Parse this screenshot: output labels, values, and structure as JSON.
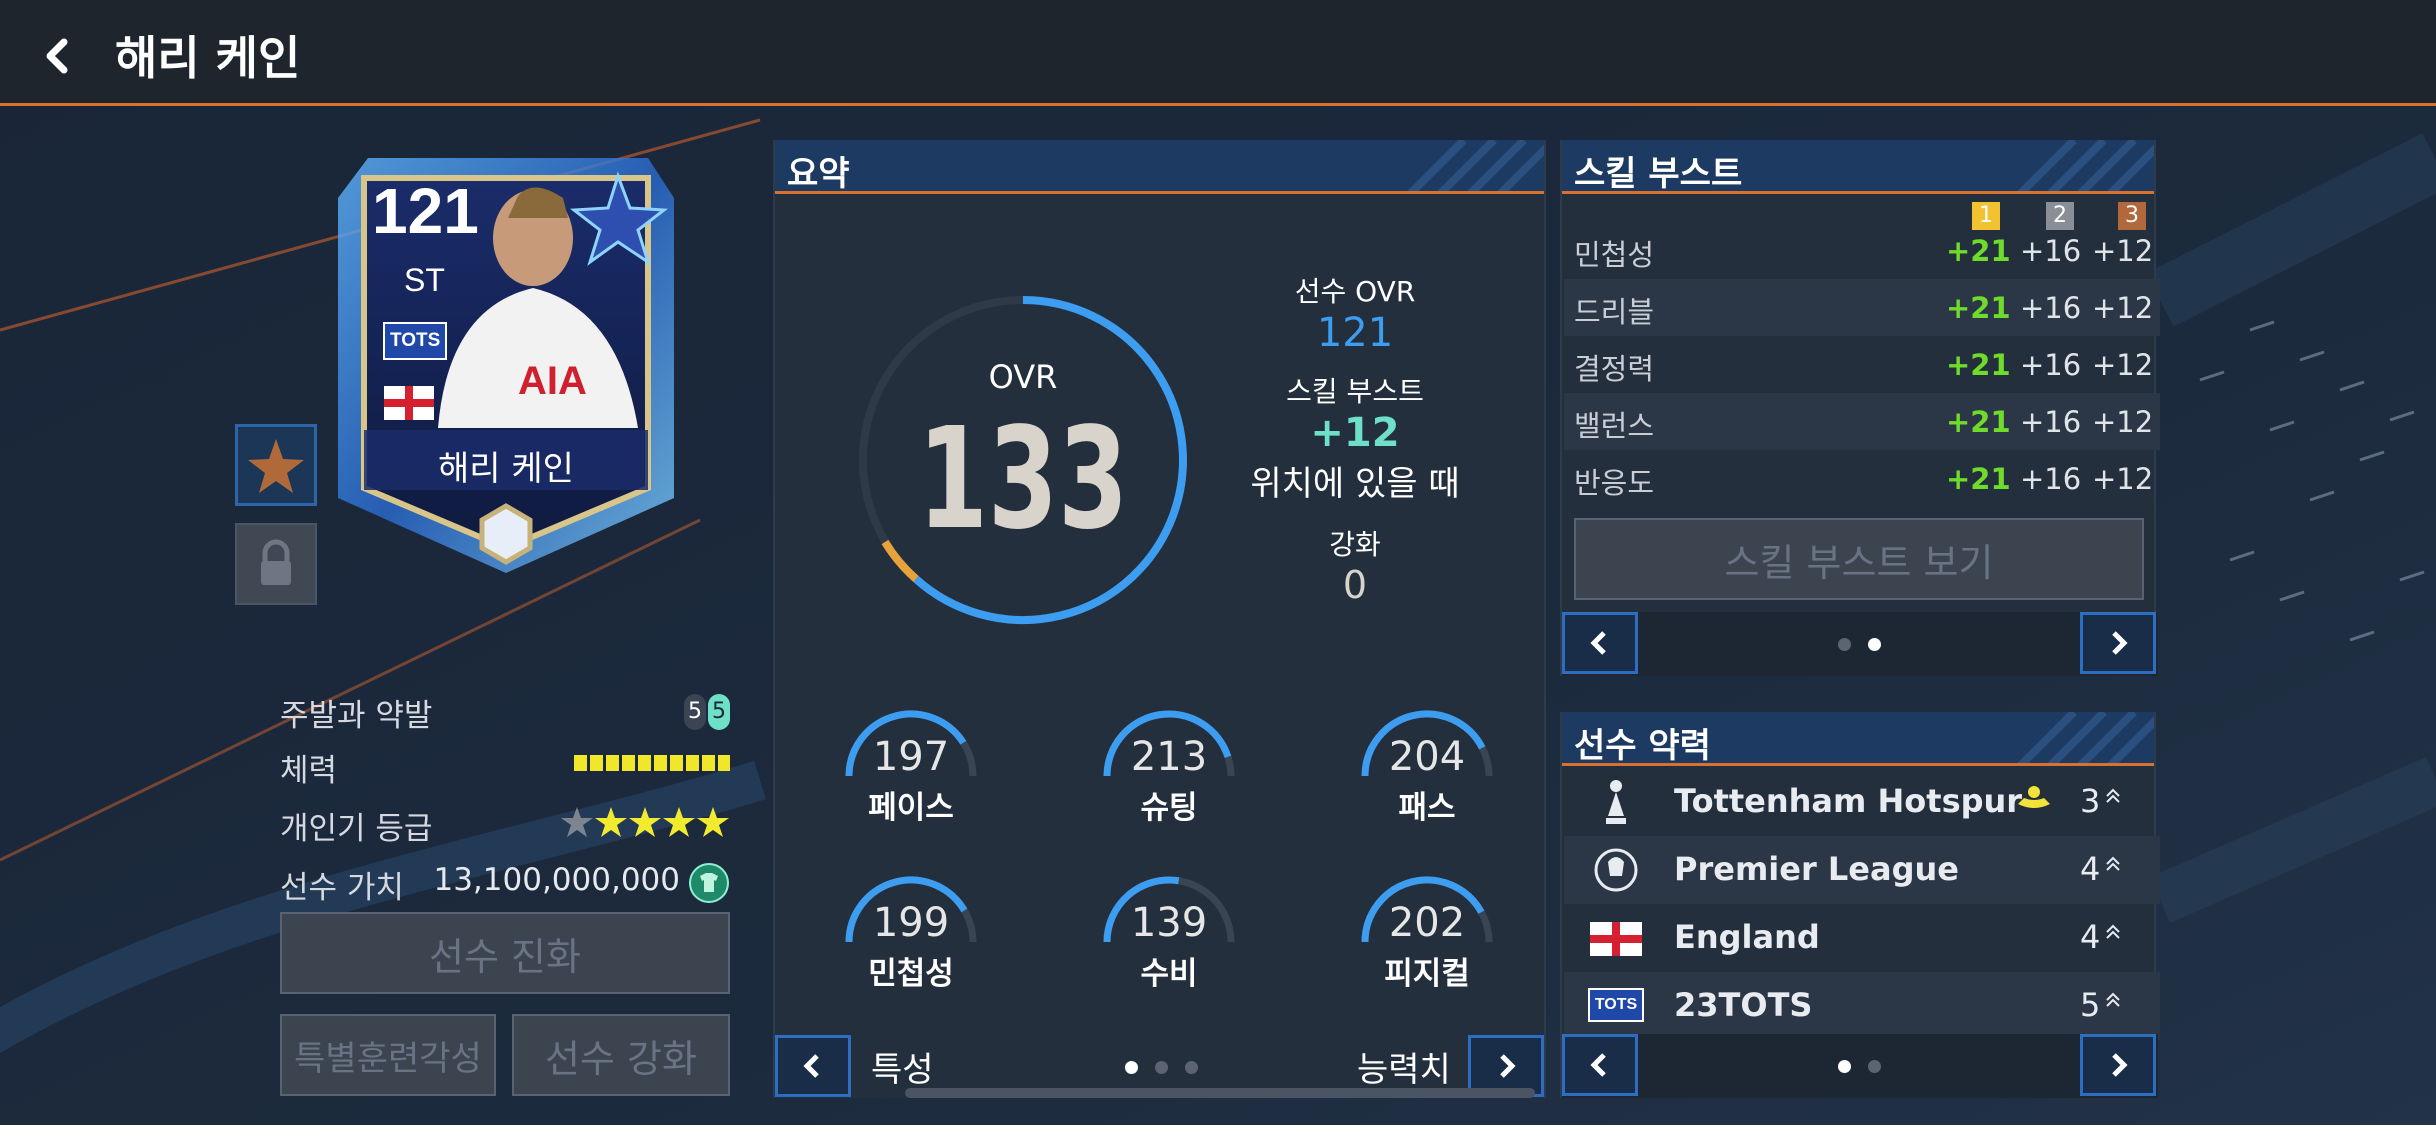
{
  "header": {
    "title": "해리 케인"
  },
  "card": {
    "ovr": "121",
    "position": "ST",
    "badge": "TOTS",
    "name": "해리 케인",
    "sponsor": "AIA"
  },
  "info": {
    "foot_label": "주발과 약발",
    "foot_left": "5",
    "foot_right": "5",
    "stamina_label": "체력",
    "stamina_fraction": 1.0,
    "popularity_label": "개인기 등급",
    "popularity_stars": 4,
    "popularity_max": 5,
    "value_label": "선수 가치",
    "value": "13,100,000,000"
  },
  "buttons": {
    "evolve": "선수 진화",
    "special_training": "특별훈련각성",
    "enhance": "선수 강화"
  },
  "summary": {
    "title": "요약",
    "ovr_label": "OVR",
    "ovr_value": "133",
    "player_ovr_label": "선수 OVR",
    "player_ovr_value": "121",
    "skill_boost_label": "스킬 부스트",
    "skill_boost_value": "+12",
    "skill_boost_note": "위치에 있을 때",
    "enhance_label": "강화",
    "enhance_value": "0",
    "stats": [
      {
        "value": "197",
        "label": "페이스",
        "fill": 0.82
      },
      {
        "value": "213",
        "label": "슈팅",
        "fill": 0.9
      },
      {
        "value": "204",
        "label": "패스",
        "fill": 0.85
      },
      {
        "value": "199",
        "label": "민첩성",
        "fill": 0.83
      },
      {
        "value": "139",
        "label": "수비",
        "fill": 0.55
      },
      {
        "value": "202",
        "label": "피지컬",
        "fill": 0.84
      }
    ],
    "footer_left": "특성",
    "footer_right": "능력치"
  },
  "skill_boost": {
    "title": "스킬 부스트",
    "levels": [
      "1",
      "2",
      "3"
    ],
    "level_colors": [
      "#f2c230",
      "#8a8f97",
      "#b0683c"
    ],
    "rows": [
      {
        "name": "민첩성",
        "v1": "+21",
        "v2": "+16",
        "v3": "+12"
      },
      {
        "name": "드리블",
        "v1": "+21",
        "v2": "+16",
        "v3": "+12"
      },
      {
        "name": "결정력",
        "v1": "+21",
        "v2": "+16",
        "v3": "+12"
      },
      {
        "name": "밸런스",
        "v1": "+21",
        "v2": "+16",
        "v3": "+12"
      },
      {
        "name": "반응도",
        "v1": "+21",
        "v2": "+16",
        "v3": "+12"
      }
    ],
    "view_button": "스킬 부스트 보기"
  },
  "chemistry": {
    "title": "선수 약력",
    "rows": [
      {
        "name": "Tottenham Hotspur",
        "level": "3",
        "icon": "club-crest-icon"
      },
      {
        "name": "Premier League",
        "level": "4",
        "icon": "league-logo-icon"
      },
      {
        "name": "England",
        "level": "4",
        "icon": "england-flag-icon"
      },
      {
        "name": "23TOTS",
        "level": "5",
        "icon": "tots-badge-icon",
        "badge": "TOTS"
      }
    ]
  },
  "colors": {
    "accent": "#d8722e",
    "ring_blue": "#3d9df0",
    "ring_orange": "#e8a23a",
    "green": "#6fdc2b",
    "teal": "#6fe0c8"
  }
}
